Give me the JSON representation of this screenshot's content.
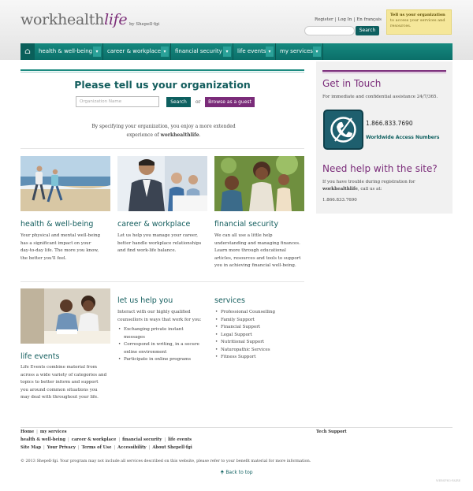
{
  "header": {
    "logo_main": "workhealth",
    "logo_life": "life",
    "byline": "by Shepell·fgi",
    "utility": [
      "Register",
      "Log In",
      "En français"
    ],
    "tip_title": "Tell us your organization",
    "tip_text": "to access your services and resources.",
    "search_label": "Search"
  },
  "nav": {
    "home_icon": "home-icon",
    "items": [
      "health & well-being",
      "career & workplace",
      "financial security",
      "life events",
      "my services"
    ]
  },
  "main": {
    "title": "Please tell us your organization",
    "org_placeholder": "Organization Name",
    "search_label": "Search",
    "or": "or",
    "guest_label": "Browse as a guest",
    "spec_line1": "By specifying your organization, you enjoy a more extended",
    "spec_line2a": "experience of ",
    "spec_brand": "workhealthlife",
    "spec_line2b": "."
  },
  "columns": [
    {
      "title": "health & well-being",
      "lines": [
        "Your physical and mental well-being",
        "has a significant impact on your",
        "day-to-day life. The more you know,",
        "the better you'll feel."
      ]
    },
    {
      "title": "career & workplace",
      "lines": [
        "Let us help you manage your career,",
        "better handle workplace relationships",
        "and find work-life balance."
      ]
    },
    {
      "title": "financial security",
      "lines": [
        "We can all use a little help",
        "understanding and managing finances.",
        "Learn more through educational",
        "articles, resources and tools to support",
        "you in achieving financial well-being."
      ]
    },
    {
      "title": "life events",
      "lines": [
        "Life Events combine material from",
        "across a wide variety of categories and",
        "topics to better inform and support",
        "you around common situations you",
        "may deal with throughout your life."
      ]
    }
  ],
  "let_us_help": {
    "title": "let us help you",
    "intro": [
      "Interact with our highly qualified",
      "counsellors in ways that work for you:"
    ],
    "bullets": [
      "Exchanging private instant",
      "messages",
      "Correspond in writing, in a secure",
      "online environment",
      "Participate in online programs"
    ]
  },
  "services": {
    "title": "services",
    "items": [
      "Professional Counselling",
      "Family Support",
      "Financial Support",
      "Legal Support",
      "Nutritional Support",
      "Naturopathic Services",
      "Fitness Support"
    ]
  },
  "sidebar": {
    "get_in_touch": "Get in Touch",
    "immediate": "For immediate and confidential assistance 24/7/365.",
    "phone": "1.866.833.7690",
    "worldwide": "Worldwide Access Numbers",
    "need_help": "Need help with the site?",
    "trouble1": "If you have trouble during registration for",
    "trouble_brand": "workhealthlife",
    "trouble2": ", call us at:",
    "help_phone": "1.866.833.7690"
  },
  "footer": {
    "row1": [
      "Home",
      "my services"
    ],
    "row2": [
      "health & well-being",
      "career & workplace",
      "financial security",
      "life events"
    ],
    "row3": [
      "Site Map",
      "Your Privacy",
      "Terms of Use",
      "Accessibility",
      "About Shepell·fgi"
    ],
    "tech": "Tech Support",
    "copyright": "© 2013 Shepell·fgi. Your program may not include all services described on this website, please refer to your benefit material for more information.",
    "back_top": "Back to top",
    "tiny": "WEBSPH3-FAIRE"
  },
  "colors": {
    "teal": "#0d5f5f",
    "purple": "#7a2b79",
    "tip_bg": "#f5e79a"
  }
}
